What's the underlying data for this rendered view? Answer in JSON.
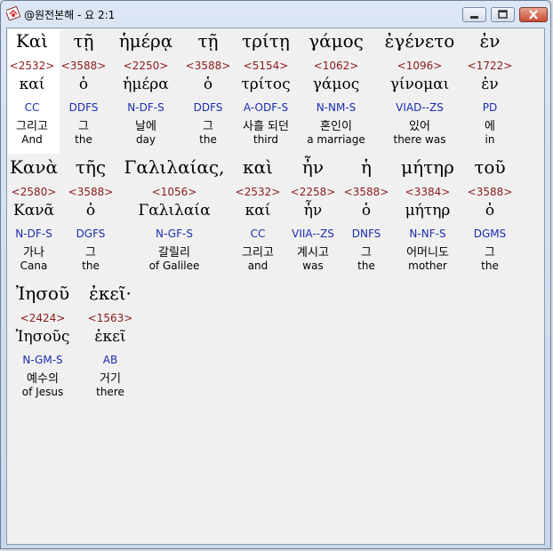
{
  "window": {
    "title": "@원전본해 - 요 2:1"
  },
  "rows": [
    {
      "words": [
        {
          "greek": "Καὶ",
          "strong": "<2532>",
          "lemma": "καί",
          "morph": "CC",
          "korean": "그리고",
          "english": "And"
        },
        {
          "greek": "τῇ",
          "strong": "<3588>",
          "lemma": "ὁ",
          "morph": "DDFS",
          "korean": "그",
          "english": "the"
        },
        {
          "greek": "ἡμέρᾳ",
          "strong": "<2250>",
          "lemma": "ἡμέρα",
          "morph": "N-DF-S",
          "korean": "날에",
          "english": "day"
        },
        {
          "greek": "τῇ",
          "strong": "<3588>",
          "lemma": "ὁ",
          "morph": "DDFS",
          "korean": "그",
          "english": "the"
        },
        {
          "greek": "τρίτῃ",
          "strong": "<5154>",
          "lemma": "τρίτος",
          "morph": "A-ODF-S",
          "korean": "사흘 되던",
          "english": "third"
        },
        {
          "greek": "γάμος",
          "strong": "<1062>",
          "lemma": "γάμος",
          "morph": "N-NM-S",
          "korean": "혼인이",
          "english": "a marriage"
        },
        {
          "greek": "ἐγένετο",
          "strong": "<1096>",
          "lemma": "γίνομαι",
          "morph": "VIAD--ZS",
          "korean": "있어",
          "english": "there was"
        },
        {
          "greek": "ἐν",
          "strong": "<1722>",
          "lemma": "ἐν",
          "morph": "PD",
          "korean": "에",
          "english": "in"
        }
      ]
    },
    {
      "words": [
        {
          "greek": "Κανὰ",
          "strong": "<2580>",
          "lemma": "Κανᾶ",
          "morph": "N-DF-S",
          "korean": "가나",
          "english": "Cana"
        },
        {
          "greek": "τῆς",
          "strong": "<3588>",
          "lemma": "ὁ",
          "morph": "DGFS",
          "korean": "그",
          "english": "the"
        },
        {
          "greek": "Γαλιλαίας,",
          "strong": "<1056>",
          "lemma": "Γαλιλαία",
          "morph": "N-GF-S",
          "korean": "갈릴리",
          "english": "of Galilee"
        },
        {
          "greek": "καὶ",
          "strong": "<2532>",
          "lemma": "καί",
          "morph": "CC",
          "korean": "그리고",
          "english": "and"
        },
        {
          "greek": "ἦν",
          "strong": "<2258>",
          "lemma": "ἦν",
          "morph": "VIIA--ZS",
          "korean": "계시고",
          "english": "was"
        },
        {
          "greek": "ἡ",
          "strong": "<3588>",
          "lemma": "ὁ",
          "morph": "DNFS",
          "korean": "그",
          "english": "the"
        },
        {
          "greek": "μήτηρ",
          "strong": "<3384>",
          "lemma": "μήτηρ",
          "morph": "N-NF-S",
          "korean": "어머니도",
          "english": "mother"
        },
        {
          "greek": "τοῦ",
          "strong": "<3588>",
          "lemma": "ὁ",
          "morph": "DGMS",
          "korean": "그",
          "english": "the"
        }
      ]
    },
    {
      "words": [
        {
          "greek": "Ἰησοῦ",
          "strong": "<2424>",
          "lemma": "Ἰησοῦς",
          "morph": "N-GM-S",
          "korean": "예수의",
          "english": "of Jesus"
        },
        {
          "greek": "ἐκεῖ·",
          "strong": "<1563>",
          "lemma": "ἐκεῖ",
          "morph": "AB",
          "korean": "거기",
          "english": "there"
        }
      ]
    }
  ]
}
